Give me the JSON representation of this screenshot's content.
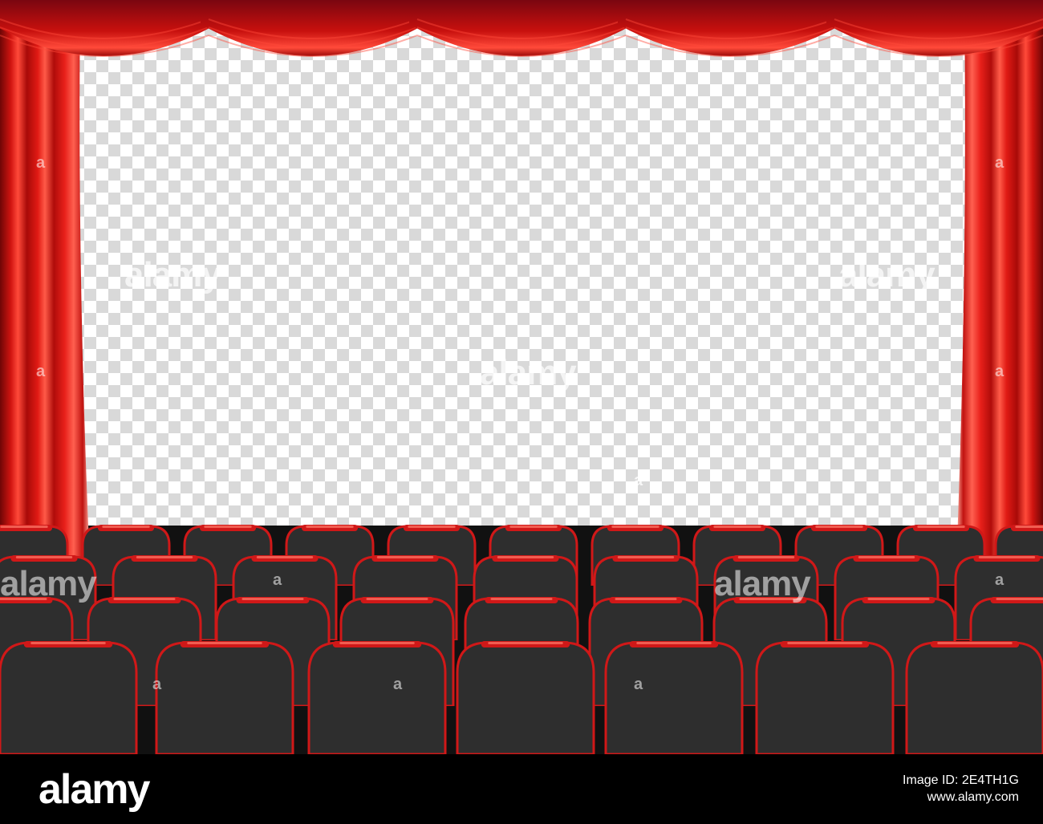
{
  "footer": {
    "logo": "alamy",
    "image_id_line": "Image ID: 2E4TH1G",
    "url": "www.alamy.com"
  },
  "watermarks": {
    "brand": "alamy",
    "small_mark": "a"
  },
  "colors": {
    "curtain": "#c8100e",
    "curtain_highlight": "#ff4a3a",
    "curtain_shadow": "#6e0606",
    "seat_back": "#2e2e2e",
    "seat_trim": "#d01818",
    "floor": "#111111",
    "footer": "#000000"
  },
  "scene": {
    "screen_style": "transparent-checkerboard",
    "seat_rows": 4
  }
}
